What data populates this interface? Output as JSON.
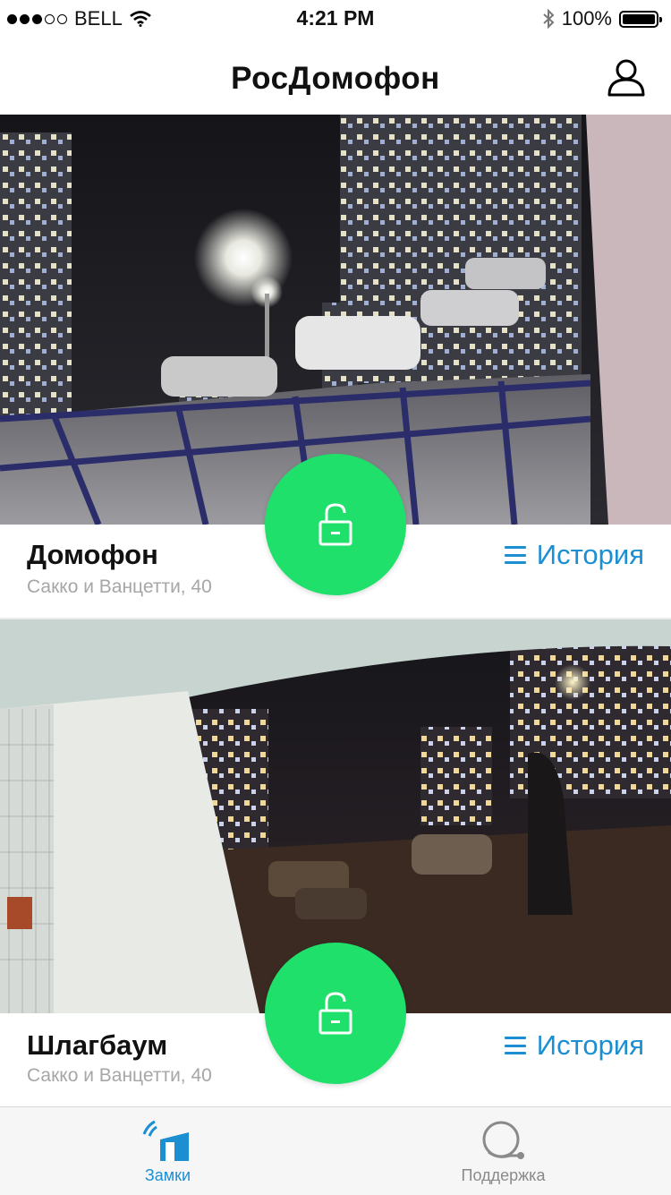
{
  "status_bar": {
    "carrier": "BELL",
    "time": "4:21 PM",
    "battery": "100%"
  },
  "header": {
    "title": "РосДомофон",
    "profile_icon": "user-icon"
  },
  "locks": [
    {
      "title": "Домофон",
      "address": "Сакко и Ванцетти, 40",
      "history_label": "История",
      "camera_scene": "night-courtyard"
    },
    {
      "title": "Шлагбаум",
      "address": "Сакко и Ванцетти, 40",
      "history_label": "История",
      "camera_scene": "night-entrance"
    }
  ],
  "tabs": [
    {
      "label": "Замки",
      "icon": "door-icon",
      "active": true
    },
    {
      "label": "Поддержка",
      "icon": "support-headset-icon",
      "active": false
    }
  ],
  "colors": {
    "accent": "#1b8fd2",
    "unlock_button": "#1fe06a",
    "subtitle_gray": "#a6a6a6",
    "tab_inactive": "#8a8a8a"
  }
}
